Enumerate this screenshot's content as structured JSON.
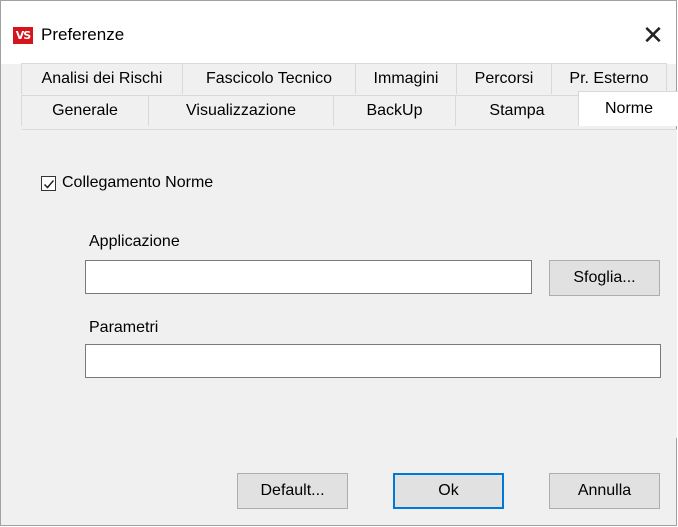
{
  "window": {
    "title": "Preferenze",
    "app_icon_text": "VS",
    "close_glyph": "✕"
  },
  "tabs": {
    "row1": [
      {
        "label": "Analisi dei Rischi"
      },
      {
        "label": "Fascicolo Tecnico"
      },
      {
        "label": "Immagini"
      },
      {
        "label": "Percorsi"
      },
      {
        "label": "Pr. Esterno"
      }
    ],
    "row2": [
      {
        "label": "Generale"
      },
      {
        "label": "Visualizzazione"
      },
      {
        "label": "BackUp"
      },
      {
        "label": "Stampa"
      },
      {
        "label": "Norme",
        "active": true
      }
    ]
  },
  "form": {
    "checkbox_label": "Collegamento Norme",
    "checkbox_checked": true,
    "applicazione_label": "Applicazione",
    "applicazione_value": "",
    "sfoglia_label": "Sfoglia...",
    "parametri_label": "Parametri",
    "parametri_value": ""
  },
  "buttons": {
    "default_label": "Default...",
    "ok_label": "Ok",
    "annulla_label": "Annulla"
  },
  "colors": {
    "accent": "#0078d7",
    "icon_red": "#d4151b"
  }
}
